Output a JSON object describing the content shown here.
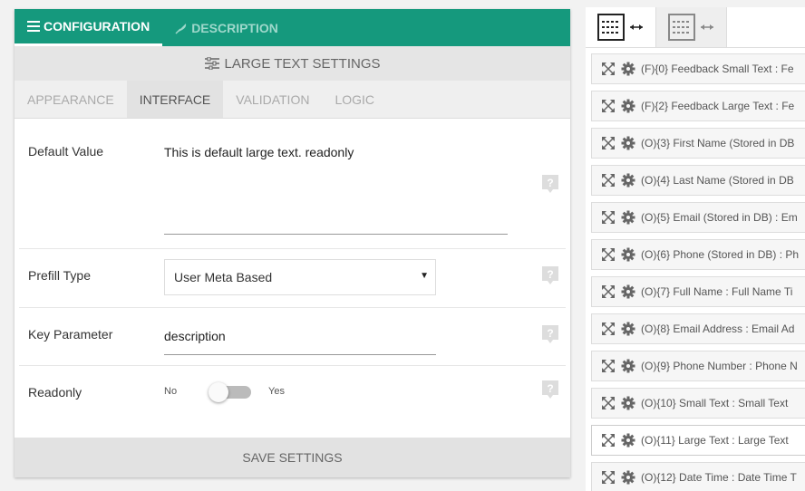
{
  "tabs": {
    "configuration": "CONFIGURATION",
    "description": "DESCRIPTION"
  },
  "section_title": "LARGE TEXT SETTINGS",
  "subtabs": [
    "APPEARANCE",
    "INTERFACE",
    "VALIDATION",
    "LOGIC"
  ],
  "fields": {
    "default_value": {
      "label": "Default Value",
      "value": "This is default large text. readonly"
    },
    "prefill_type": {
      "label": "Prefill Type",
      "value": "User Meta Based"
    },
    "key_parameter": {
      "label": "Key Parameter",
      "value": "description"
    },
    "readonly": {
      "label": "Readonly",
      "off": "No",
      "on": "Yes"
    }
  },
  "save_label": "SAVE SETTINGS",
  "field_list": [
    "(F){0} Feedback Small Text : Fe",
    "(F){2} Feedback Large Text : Fe",
    "(O){3} First Name (Stored in DB",
    "(O){4} Last Name (Stored in DB",
    "(O){5} Email (Stored in DB) : Em",
    "(O){6} Phone (Stored in DB) : Ph",
    "(O){7} Full Name : Full Name Ti",
    "(O){8} Email Address : Email Ad",
    "(O){9} Phone Number : Phone N",
    "(O){10} Small Text : Small Text",
    "(O){11} Large Text : Large Text",
    "(O){12} Date Time : Date Time T"
  ],
  "colors": {
    "accent": "#15997d"
  }
}
